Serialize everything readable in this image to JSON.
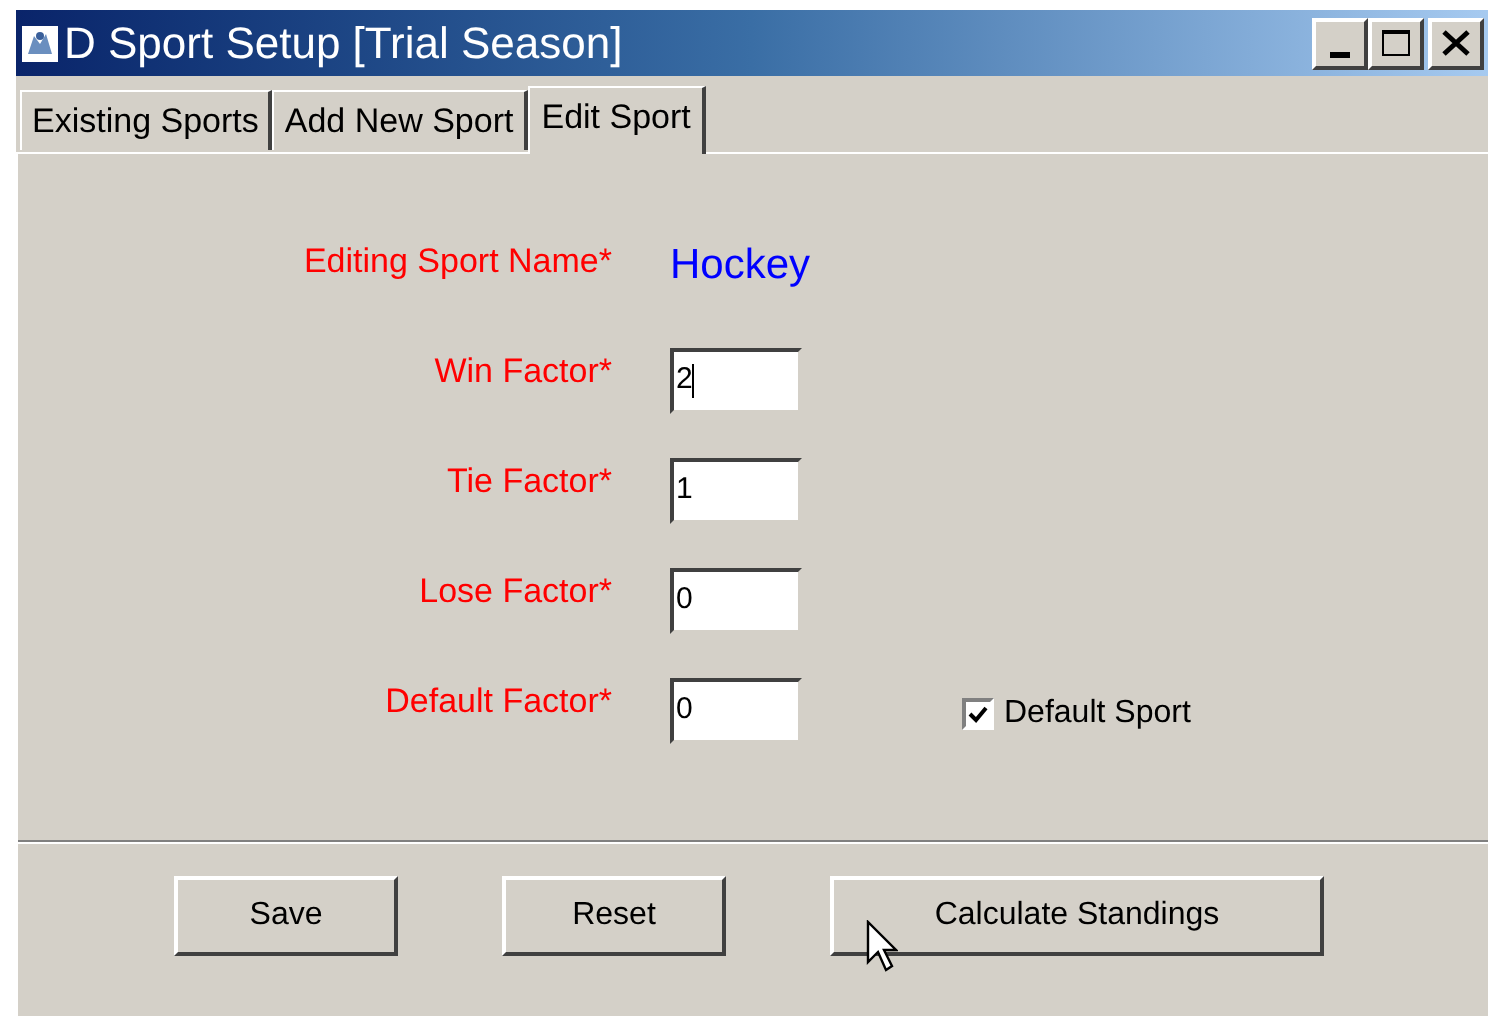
{
  "window": {
    "title": "D Sport Setup [Trial Season]"
  },
  "tabs": [
    {
      "label": "Existing Sports",
      "selected": false
    },
    {
      "label": "Add New Sport",
      "selected": false
    },
    {
      "label": "Edit Sport",
      "selected": true
    }
  ],
  "form": {
    "name_label": "Editing Sport Name*",
    "name_value": "Hockey",
    "fields": [
      {
        "label": "Win Factor*",
        "value": "2",
        "focused": true
      },
      {
        "label": "Tie Factor*",
        "value": "1",
        "focused": false
      },
      {
        "label": "Lose Factor*",
        "value": "0",
        "focused": false
      },
      {
        "label": "Default Factor*",
        "value": "0",
        "focused": false
      }
    ],
    "default_sport": {
      "label": "Default Sport",
      "checked": true
    }
  },
  "buttons": [
    "Save",
    "Reset",
    "Calculate Standings"
  ]
}
